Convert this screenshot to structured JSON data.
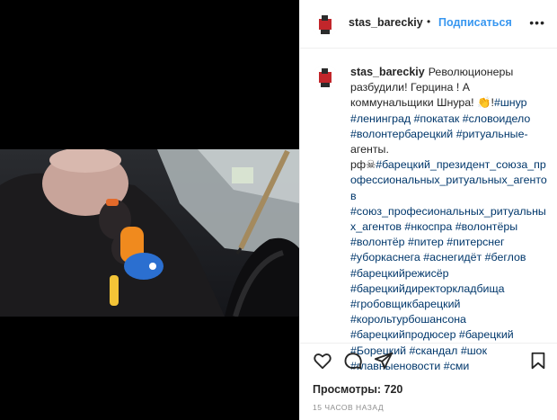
{
  "post": {
    "username": "stas_bareckiy",
    "follow_label": "Подписаться",
    "more_label": "•••",
    "caption_username": "stas_bareckiy",
    "caption_text": "Революционеры разбудили! Герцина ! А коммунальщики Шнура! 👏!",
    "caption_mid": "агенты. рф☠",
    "hashtags_a": [
      "#шнур",
      "#ленинград",
      "#покатак",
      "#словоидело",
      "#волонтербарецкий",
      "#ритуальные-"
    ],
    "hashtags_b": [
      "#барецкий_президент_союза_профессиональных_ритуальных_агентов",
      "#союз_професиональных_ритуальных_агентов",
      "#нкоспра",
      "#волонтёры",
      "#волонтёр",
      "#питер",
      "#питерснег",
      "#уборкаснега",
      "#аснегидёт",
      "#беглов",
      "#барецкийрежисёр",
      "#барецкийдиректоркладбища",
      "#гробовщикбарецкий",
      "#корольтурбошансона",
      "#барецкийпродюсер",
      "#барецкий",
      "#Борецкий",
      "#скандал",
      "#шок",
      "#главныеновости",
      "#сми"
    ],
    "views_label": "Просмотры:",
    "views_count": "720",
    "timestamp": "15 ЧАСОВ НАЗАД"
  },
  "icons": {
    "like": "heart-icon",
    "comment": "comment-icon",
    "share": "share-icon",
    "save": "bookmark-icon"
  },
  "colors": {
    "link": "#3897f0",
    "hashtag": "#00376b",
    "text": "#262626",
    "muted": "#8e8e8e"
  }
}
